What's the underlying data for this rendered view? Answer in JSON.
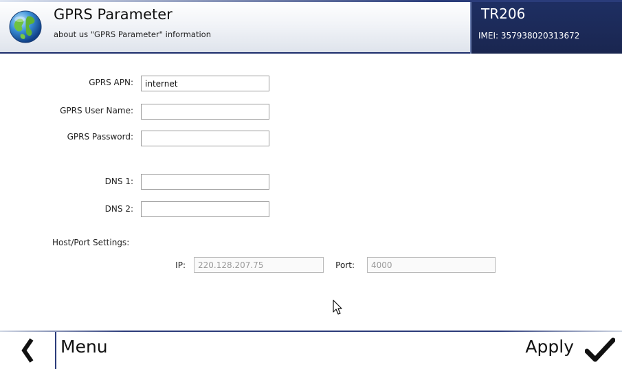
{
  "header": {
    "title": "GPRS Parameter",
    "subtitle": "about us \"GPRS Parameter\" information",
    "device_name": "TR206",
    "imei": "IMEI: 357938020313672",
    "logo_icon": "globe-icon"
  },
  "form": {
    "apn": {
      "label": "GPRS APN:",
      "value": "internet"
    },
    "user": {
      "label": "GPRS User Name:",
      "value": ""
    },
    "password": {
      "label": "GPRS Password:",
      "value": ""
    },
    "dns1": {
      "label": "DNS 1:",
      "value": ""
    },
    "dns2": {
      "label": "DNS 2:",
      "value": ""
    },
    "host_section_label": "Host/Port Settings:",
    "ip": {
      "label": "IP:",
      "placeholder": "220.128.207.75"
    },
    "port": {
      "label": "Port:",
      "placeholder": "4000"
    }
  },
  "footer": {
    "menu_label": "Menu",
    "apply_label": "Apply",
    "back_icon": "chevron-left-icon",
    "apply_icon": "checkmark-icon"
  },
  "colors": {
    "header_dark": "#1e2f63",
    "accent_border": "#2b3b7a"
  }
}
